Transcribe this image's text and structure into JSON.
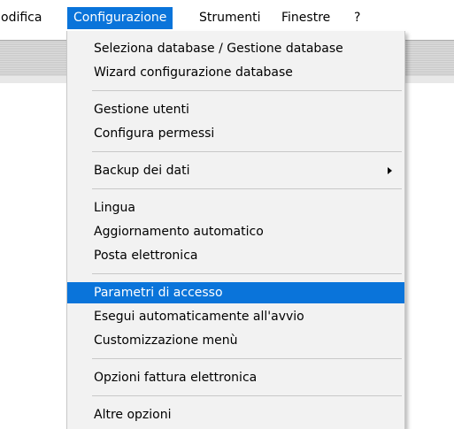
{
  "menubar": {
    "items": [
      {
        "label": "odifica"
      },
      {
        "label": "Configurazione"
      },
      {
        "label": "Strumenti"
      },
      {
        "label": "Finestre"
      },
      {
        "label": "?"
      }
    ],
    "active_index": 1
  },
  "dropdown": {
    "items": [
      {
        "label": "Seleziona database / Gestione database"
      },
      {
        "label": "Wizard configurazione database"
      },
      {
        "label": "Gestione utenti"
      },
      {
        "label": "Configura permessi"
      },
      {
        "label": "Backup dei dati",
        "submenu": true
      },
      {
        "label": "Lingua"
      },
      {
        "label": "Aggiornamento automatico"
      },
      {
        "label": "Posta elettronica"
      },
      {
        "label": "Parametri di accesso",
        "highlighted": true
      },
      {
        "label": "Esegui automaticamente all'avvio"
      },
      {
        "label": "Customizzazione menù"
      },
      {
        "label": "Opzioni fattura elettronica"
      },
      {
        "label": "Altre opzioni"
      }
    ]
  },
  "colors": {
    "highlight": "#0a74da",
    "menu_background": "#f2f2f2"
  }
}
